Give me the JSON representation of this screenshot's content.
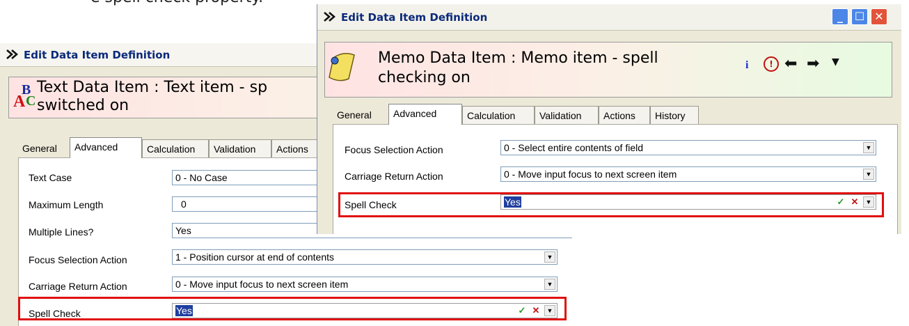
{
  "caption": "e spell check property.",
  "back_window": {
    "title": "Edit Data Item Definition",
    "header": "Text Data Item : Text item - spell check switched on",
    "header_line1": "Text Data Item : Text item - sp",
    "header_line2": "switched on",
    "tabs": [
      "General",
      "Advanced",
      "Calculation",
      "Validation",
      "Actions"
    ],
    "active_tab": "Advanced",
    "rows": [
      {
        "label": "Text Case",
        "value": "0 - No Case"
      },
      {
        "label": "Maximum Length",
        "value": "0"
      },
      {
        "label": "Multiple Lines?",
        "value": "Yes"
      },
      {
        "label": "Focus Selection Action",
        "value": "1 - Position cursor at end of contents"
      },
      {
        "label": "Carriage Return Action",
        "value": "0 - Move input focus to next screen item"
      },
      {
        "label": "Spell Check",
        "value": "Yes"
      }
    ]
  },
  "front_window": {
    "title": "Edit Data Item Definition",
    "header_line1": "Memo Data Item : Memo item - spell",
    "header_line2": "checking on",
    "tabs": [
      "General",
      "Advanced",
      "Calculation",
      "Validation",
      "Actions",
      "History"
    ],
    "active_tab": "Advanced",
    "rows": [
      {
        "label": "Focus Selection Action",
        "value": "0 - Select entire contents of field"
      },
      {
        "label": "Carriage Return Action",
        "value": "0 - Move input focus to next screen item"
      },
      {
        "label": "Spell Check",
        "value": "Yes"
      }
    ],
    "toolbar_icons": [
      "info-icon",
      "warning-icon",
      "back-arrow-icon",
      "forward-arrow-icon",
      "dropdown-icon"
    ]
  },
  "colors": {
    "highlight": "#e01010",
    "title_text": "#0b2a7a",
    "selection": "#1f3f9f",
    "close_button": "#e2533a",
    "window_button": "#3d7bdc"
  }
}
